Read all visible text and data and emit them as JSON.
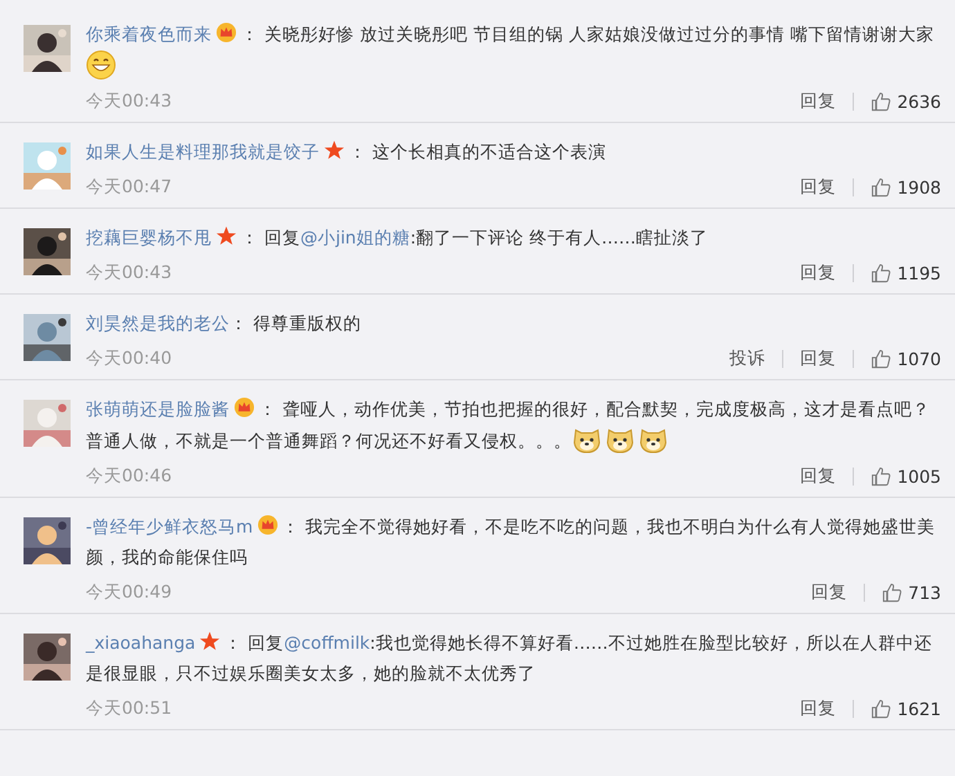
{
  "comments": [
    {
      "user": "你乘着夜色而来",
      "badge": {
        "kind": "crown"
      },
      "parts": [
        {
          "kind": "text",
          "text": "： 关晓彤好惨 放过关晓彤吧 节目组的锅 人家姑娘没做过过分的事情 嘴下留情谢谢大家"
        },
        {
          "kind": "emoji-grin"
        }
      ],
      "time": "今天00:43",
      "actions": [
        "回复"
      ],
      "likes": "2636"
    },
    {
      "user": "如果人生是料理那我就是饺子",
      "badge": {
        "kind": "star"
      },
      "parts": [
        {
          "kind": "text",
          "text": "： 这个长相真的不适合这个表演"
        }
      ],
      "time": "今天00:47",
      "actions": [
        "回复"
      ],
      "likes": "1908"
    },
    {
      "user": "挖藕巨婴杨不甩",
      "badge": {
        "kind": "star"
      },
      "parts": [
        {
          "kind": "text",
          "text": "： 回复"
        },
        {
          "kind": "link",
          "text": "@小jin姐的糖"
        },
        {
          "kind": "text",
          "text": ":翻了一下评论 终于有人……瞎扯淡了"
        }
      ],
      "time": "今天00:43",
      "actions": [
        "回复"
      ],
      "likes": "1195"
    },
    {
      "user": "刘昊然是我的老公",
      "parts": [
        {
          "kind": "text",
          "text": "： 得尊重版权的"
        }
      ],
      "time": "今天00:40",
      "actions": [
        "投诉",
        "回复"
      ],
      "likes": "1070"
    },
    {
      "user": "张萌萌还是脸脸酱",
      "badge": {
        "kind": "crown"
      },
      "parts": [
        {
          "kind": "text",
          "text": "： 聋哑人，动作优美，节拍也把握的很好，配合默契，完成度极高，这才是看点吧？普通人做，不就是一个普通舞蹈？何况还不好看又侵权。。。"
        },
        {
          "kind": "emoji-dog"
        },
        {
          "kind": "emoji-dog"
        },
        {
          "kind": "emoji-dog"
        }
      ],
      "time": "今天00:46",
      "actions": [
        "回复"
      ],
      "likes": "1005"
    },
    {
      "user": "-曾经年少鲜衣怒马m",
      "badge": {
        "kind": "crown"
      },
      "parts": [
        {
          "kind": "text",
          "text": "： 我完全不觉得她好看，不是吃不吃的问题，我也不明白为什么有人觉得她盛世美颜，我的命能保住吗"
        }
      ],
      "time": "今天00:49",
      "actions": [
        "回复"
      ],
      "likes": "713"
    },
    {
      "user": "_xiaoahanga",
      "badge": {
        "kind": "star"
      },
      "parts": [
        {
          "kind": "text",
          "text": "： 回复"
        },
        {
          "kind": "link",
          "text": "@coffmilk"
        },
        {
          "kind": "text",
          "text": ":我也觉得她长得不算好看……不过她胜在脸型比较好，所以在人群中还是很显眼，只不过娱乐圈美女太多，她的脸就不太优秀了"
        }
      ],
      "time": "今天00:51",
      "actions": [
        "回复"
      ],
      "likes": "1621"
    }
  ]
}
